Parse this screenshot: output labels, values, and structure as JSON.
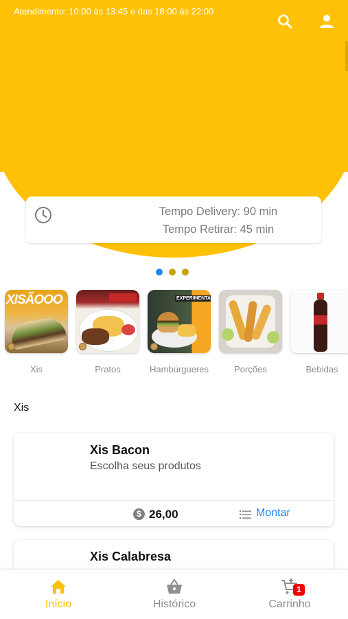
{
  "header": {
    "hours": "Atendimento: 10:00 às 13:45 e das 18:00 às 22:00",
    "search_icon": "search-icon",
    "profile_icon": "user-icon"
  },
  "colors": {
    "brand": "#ffc107",
    "accent": "#1e88e5",
    "badge": "#e00000"
  },
  "delivery": {
    "delivery_time": "Tempo Delivery: 90 min",
    "pickup_time": "Tempo Retirar: 45 min",
    "icon": "clock-icon"
  },
  "carousel": {
    "pages": 3,
    "active": 1
  },
  "categories": [
    {
      "label": "Xis",
      "image_text": "XISÃOOO"
    },
    {
      "label": "Pratos",
      "image_text": ""
    },
    {
      "label": "Hambúrgueres",
      "image_text": "EXPERIMENTAR"
    },
    {
      "label": "Porções",
      "image_text": ""
    },
    {
      "label": "Bebidas",
      "image_text": ""
    }
  ],
  "section": {
    "title": "Xis"
  },
  "products": [
    {
      "name": "Xis Bacon",
      "description": "Escolha seus produtos",
      "currency_icon": "$",
      "price": "26,00",
      "action": "Montar"
    },
    {
      "name": "Xis Calabresa"
    }
  ],
  "nav": {
    "items": [
      {
        "label": "Início",
        "icon": "home-icon",
        "active": true
      },
      {
        "label": "Histórico",
        "icon": "basket-icon",
        "active": false
      },
      {
        "label": "Carrinho",
        "icon": "cart-icon",
        "active": false
      }
    ],
    "cart_count": "1"
  }
}
